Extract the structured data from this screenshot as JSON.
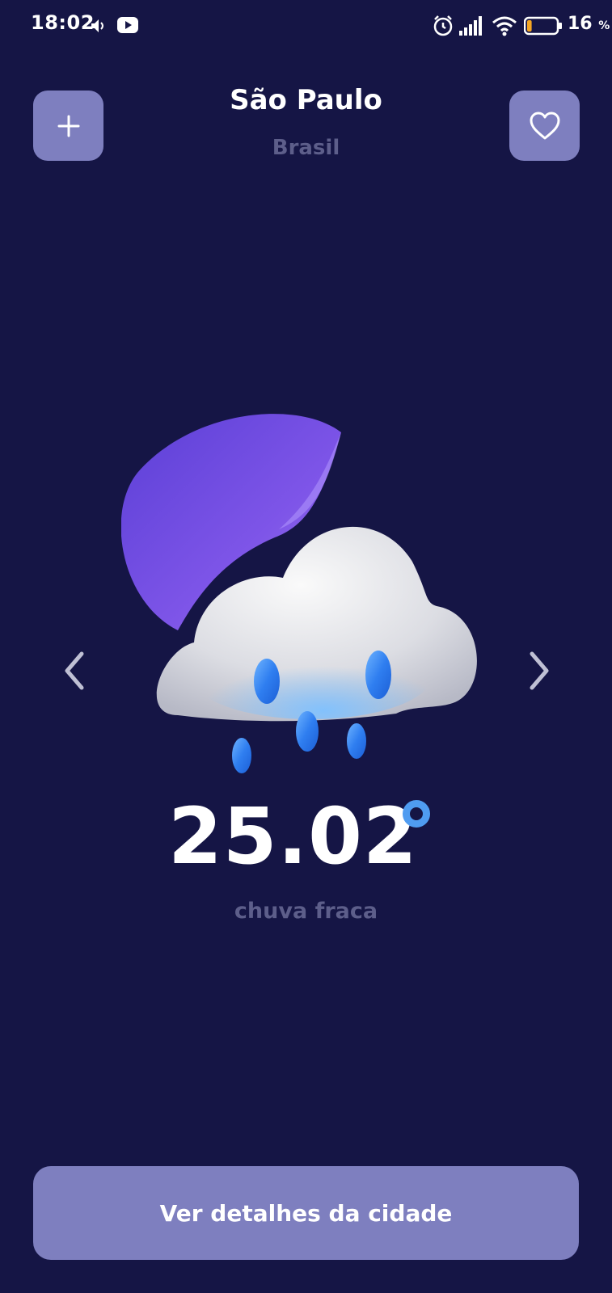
{
  "status_bar": {
    "time": "18:02",
    "battery_percent": "16",
    "battery_unit": "%",
    "battery_level": 0.16,
    "battery_color": "#f5a623",
    "icons": [
      "volume-icon",
      "youtube-icon",
      "alarm-icon",
      "signal-icon",
      "wifi-icon",
      "battery-icon"
    ]
  },
  "header": {
    "city": "São Paulo",
    "country": "Brasil",
    "add_icon": "plus-icon",
    "favorite_icon": "heart-icon"
  },
  "weather": {
    "temperature": "25.02",
    "degree_symbol": "°",
    "condition": "chuva fraca",
    "illustration": "moon-cloud-rain-icon"
  },
  "navigation": {
    "prev_icon": "chevron-left-icon",
    "next_icon": "chevron-right-icon"
  },
  "footer": {
    "details_button_label": "Ver detalhes da cidade"
  },
  "colors": {
    "background": "#151545",
    "button": "#7e7fbf",
    "muted_text": "#5d5e8a",
    "accent_degree": "#4f9cf1"
  }
}
